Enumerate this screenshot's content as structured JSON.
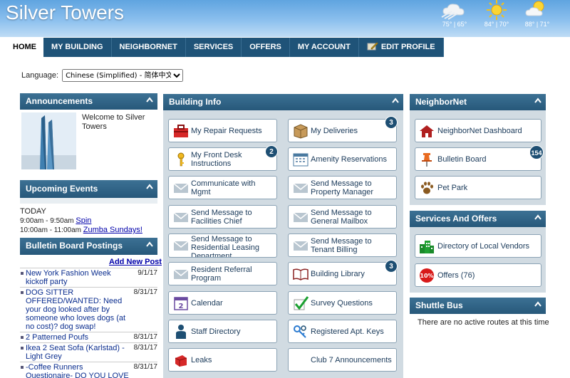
{
  "site": {
    "title": "Silver Towers"
  },
  "weather": [
    {
      "icon": "cloud-wind-icon",
      "temps": "75° | 65°"
    },
    {
      "icon": "sun-icon",
      "temps": "84° | 70°"
    },
    {
      "icon": "partly-sunny-icon",
      "temps": "88° | 71°"
    }
  ],
  "nav": [
    "HOME",
    "MY BUILDING",
    "NEIGHBORNET",
    "SERVICES",
    "OFFERS",
    "MY ACCOUNT",
    "EDIT PROFILE"
  ],
  "language": {
    "label": "Language:",
    "selected": "Chinese (Simplified) - 简体中文"
  },
  "announcements": {
    "title": "Announcements",
    "text": "Welcome to Silver Towers"
  },
  "events": {
    "title": "Upcoming Events",
    "day": "TODAY",
    "items": [
      {
        "time": "9:00am - 9:50am",
        "name": "Spin"
      },
      {
        "time": "10:00am - 11:00am",
        "name": "Zumba Sundays!"
      }
    ]
  },
  "bulletin": {
    "title": "Bulletin Board Postings",
    "add_label": "Add New Post",
    "posts": [
      {
        "title": "New York Fashion Week kickoff party",
        "date": "9/1/17"
      },
      {
        "title": "DOG SITTER OFFERED/WANTED: Need your dog looked after by someone who loves dogs (at no cost)? dog swap!",
        "date": "8/31/17"
      },
      {
        "title": "2 Patterned Poufs",
        "date": "8/31/17"
      },
      {
        "title": "Ikea 2 Seat Sofa (Karlstad) - Light Grey",
        "date": "8/31/17"
      },
      {
        "title": "-Coffee Runners Questionaire- DO YOU LOVE COFFEE-",
        "date": "8/31/17"
      }
    ]
  },
  "building_info": {
    "title": "Building Info",
    "tiles": [
      {
        "label": "My Repair Requests",
        "icon": "toolbox-icon"
      },
      {
        "label": "My Deliveries",
        "icon": "package-icon",
        "badge": "3"
      },
      {
        "label": "My Front Desk Instructions",
        "icon": "key-icon",
        "badge": "2"
      },
      {
        "label": "Amenity Reservations",
        "icon": "calendar-grid-icon"
      },
      {
        "label": "Communicate with Mgmt",
        "icon": "envelope-icon"
      },
      {
        "label": "Send Message to Property Manager",
        "icon": "envelope-icon"
      },
      {
        "label": "Send Message to Facilities Chief",
        "icon": "envelope-icon"
      },
      {
        "label": "Send Message to General Mailbox",
        "icon": "envelope-icon"
      },
      {
        "label": "Send Message to Residential Leasing Department",
        "icon": "envelope-icon"
      },
      {
        "label": "Send Message to Tenant Billing",
        "icon": "envelope-icon"
      },
      {
        "label": "Resident Referral Program",
        "icon": "envelope-icon"
      },
      {
        "label": "Building Library",
        "icon": "book-icon",
        "badge": "3"
      },
      {
        "label": "Calendar",
        "icon": "calendar-icon"
      },
      {
        "label": "Survey Questions",
        "icon": "checkmark-icon"
      },
      {
        "label": "Staff Directory",
        "icon": "person-icon"
      },
      {
        "label": "Registered Apt. Keys",
        "icon": "keys-icon"
      },
      {
        "label": "Leaks",
        "icon": "leak-icon"
      },
      {
        "label": "Club 7 Announcements",
        "icon": ""
      }
    ]
  },
  "neighbornet": {
    "title": "NeighborNet",
    "tiles": [
      {
        "label": "NeighborNet Dashboard",
        "icon": "house-icon"
      },
      {
        "label": "Bulletin Board",
        "icon": "pushpin-icon",
        "badge": "154"
      },
      {
        "label": "Pet Park",
        "icon": "paw-icon"
      }
    ]
  },
  "services": {
    "title": "Services And Offers",
    "tiles": [
      {
        "label": "Directory of Local Vendors",
        "icon": "buildings-icon"
      },
      {
        "label": "Offers (76)",
        "icon": "discount-icon",
        "icon_text": "10%"
      }
    ]
  },
  "shuttle": {
    "title": "Shuttle Bus",
    "text": "There are no active routes at this time"
  },
  "colors": {
    "nav_bg": "#1f5378",
    "panel_head": "#2e6385",
    "panel_body": "#d1dbe2",
    "badge": "#1e4f73",
    "link": "#0b2e8f"
  }
}
